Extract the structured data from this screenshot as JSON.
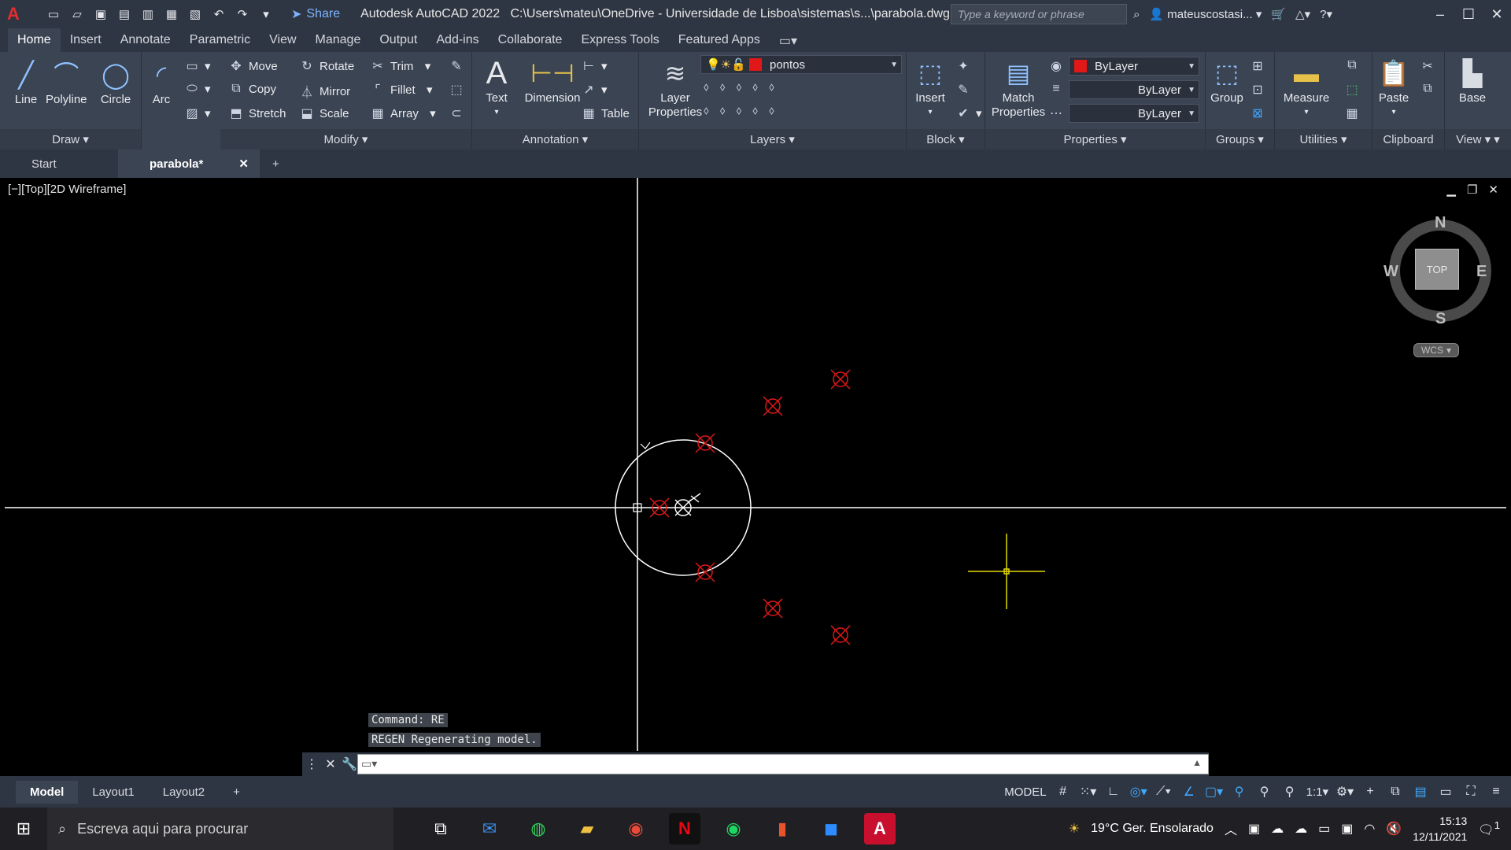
{
  "titlebar": {
    "app_title": "Autodesk AutoCAD 2022",
    "file_path": "C:\\Users\\mateu\\OneDrive - Universidade de Lisboa\\sistemas\\s...\\parabola.dwg",
    "share_label": "Share",
    "search_placeholder": "Type a keyword or phrase",
    "username": "mateuscostasi..."
  },
  "ribbon_tabs": [
    "Home",
    "Insert",
    "Annotate",
    "Parametric",
    "View",
    "Manage",
    "Output",
    "Add-ins",
    "Collaborate",
    "Express Tools",
    "Featured Apps"
  ],
  "panels": {
    "draw": {
      "title": "Draw",
      "line": "Line",
      "polyline": "Polyline",
      "circle": "Circle",
      "arc": "Arc"
    },
    "modify": {
      "title": "Modify",
      "move": "Move",
      "rotate": "Rotate",
      "trim": "Trim",
      "copy": "Copy",
      "mirror": "Mirror",
      "fillet": "Fillet",
      "stretch": "Stretch",
      "scale": "Scale",
      "array": "Array"
    },
    "annotation": {
      "title": "Annotation",
      "text": "Text",
      "dimension": "Dimension",
      "table": "Table"
    },
    "layers": {
      "title": "Layers",
      "layer_properties": "Layer Properties",
      "current_layer": "pontos"
    },
    "block": {
      "title": "Block",
      "insert": "Insert"
    },
    "properties": {
      "title": "Properties",
      "match_properties": "Match Properties",
      "color": "ByLayer",
      "linetype": "ByLayer",
      "lineweight": "ByLayer"
    },
    "groups": {
      "title": "Groups",
      "group": "Group"
    },
    "utilities": {
      "title": "Utilities",
      "measure": "Measure"
    },
    "clipboard": {
      "title": "Clipboard",
      "paste": "Paste"
    },
    "view": {
      "title": "View",
      "base": "Base"
    }
  },
  "file_tabs": {
    "start": "Start",
    "current": "parabola*"
  },
  "viewport": {
    "label": "[−][Top][2D Wireframe]"
  },
  "viewcube": {
    "north": "N",
    "south": "S",
    "east": "E",
    "west": "W",
    "face": "TOP",
    "ucs": "WCS"
  },
  "command": {
    "history": [
      "Command: RE",
      "REGEN Regenerating model."
    ]
  },
  "layout_tabs": [
    "Model",
    "Layout1",
    "Layout2"
  ],
  "status": {
    "space": "MODEL",
    "scale": "1:1"
  },
  "taskbar": {
    "search_placeholder": "Escreva aqui para procurar",
    "weather": "19°C  Ger. Ensolarado",
    "time": "15:13",
    "date": "12/11/2021",
    "notifications": "1"
  },
  "colors": {
    "accent": "#e01818",
    "ucs_axes": "#ffffff",
    "crosshair": "#e2d800",
    "ribbon_bg": "#3b4453"
  }
}
